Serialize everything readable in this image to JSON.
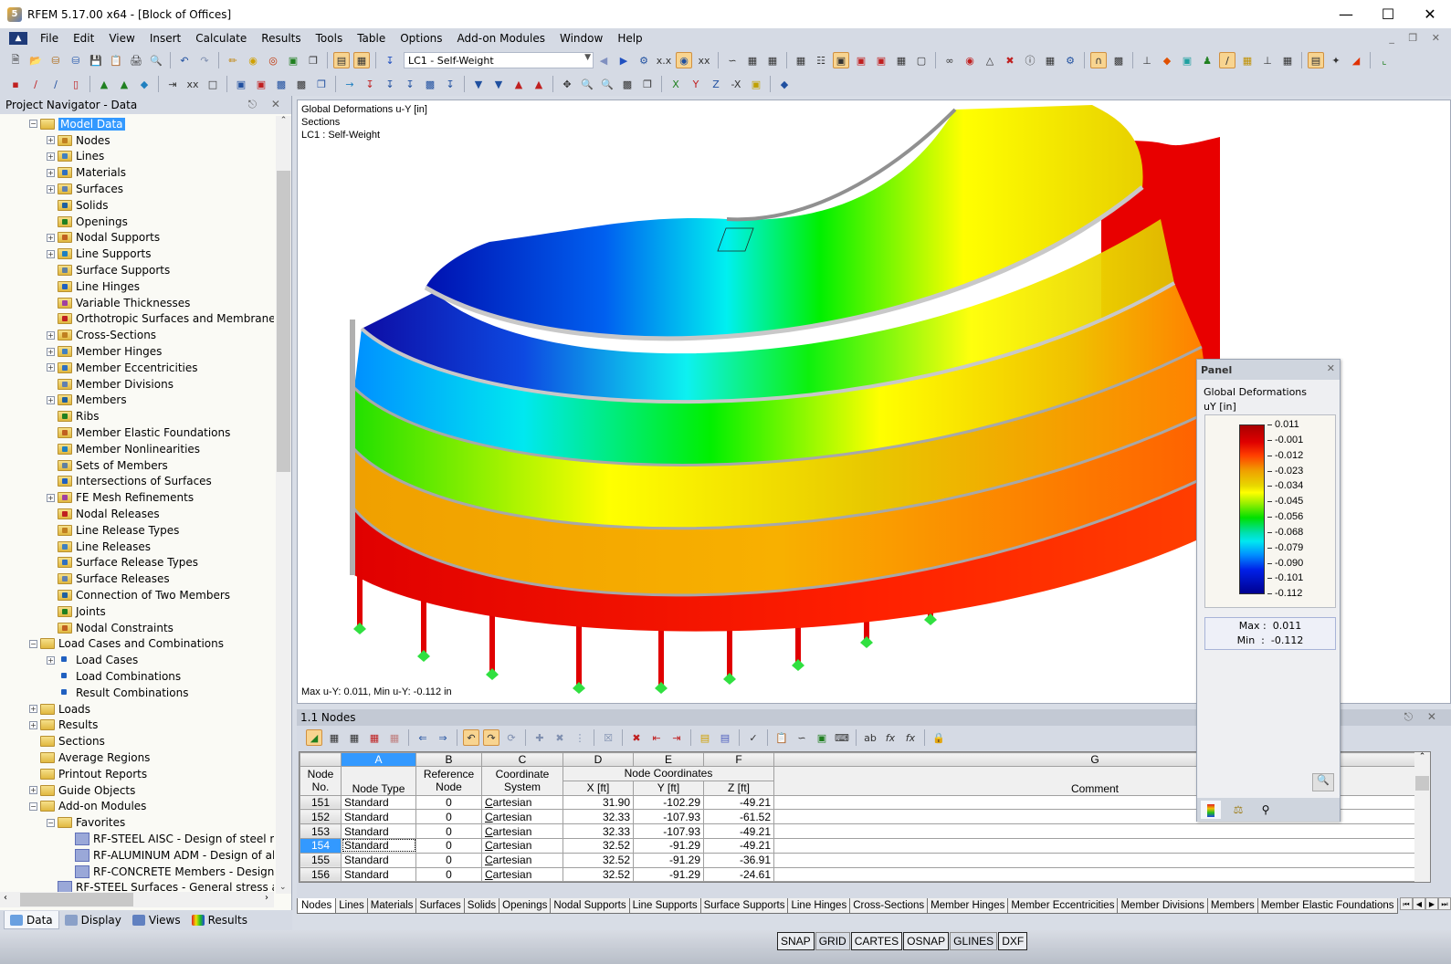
{
  "window": {
    "title": "RFEM 5.17.00 x64 - [Block of Offices]",
    "app_icon": "rfem-logo-icon",
    "controls": [
      "minimize",
      "maximize",
      "close"
    ]
  },
  "menu": {
    "items": [
      "File",
      "Edit",
      "View",
      "Insert",
      "Calculate",
      "Results",
      "Tools",
      "Table",
      "Options",
      "Add-on Modules",
      "Window",
      "Help"
    ]
  },
  "toolbar": {
    "load_case_selected": "LC1 - Self-Weight"
  },
  "navigator": {
    "title": "Project Navigator - Data",
    "items": [
      {
        "label": "Model Data",
        "level": 0,
        "expander": "minus",
        "selected": true
      },
      {
        "label": "Nodes",
        "level": 1,
        "expander": "plus"
      },
      {
        "label": "Lines",
        "level": 1,
        "expander": "plus"
      },
      {
        "label": "Materials",
        "level": 1,
        "expander": "plus"
      },
      {
        "label": "Surfaces",
        "level": 1,
        "expander": "plus"
      },
      {
        "label": "Solids",
        "level": 1,
        "expander": "none"
      },
      {
        "label": "Openings",
        "level": 1,
        "expander": "none"
      },
      {
        "label": "Nodal Supports",
        "level": 1,
        "expander": "plus"
      },
      {
        "label": "Line Supports",
        "level": 1,
        "expander": "plus"
      },
      {
        "label": "Surface Supports",
        "level": 1,
        "expander": "none"
      },
      {
        "label": "Line Hinges",
        "level": 1,
        "expander": "none"
      },
      {
        "label": "Variable Thicknesses",
        "level": 1,
        "expander": "none"
      },
      {
        "label": "Orthotropic Surfaces and Membranes",
        "level": 1,
        "expander": "none"
      },
      {
        "label": "Cross-Sections",
        "level": 1,
        "expander": "plus"
      },
      {
        "label": "Member Hinges",
        "level": 1,
        "expander": "plus"
      },
      {
        "label": "Member Eccentricities",
        "level": 1,
        "expander": "plus"
      },
      {
        "label": "Member Divisions",
        "level": 1,
        "expander": "none"
      },
      {
        "label": "Members",
        "level": 1,
        "expander": "plus"
      },
      {
        "label": "Ribs",
        "level": 1,
        "expander": "none"
      },
      {
        "label": "Member Elastic Foundations",
        "level": 1,
        "expander": "none"
      },
      {
        "label": "Member Nonlinearities",
        "level": 1,
        "expander": "none"
      },
      {
        "label": "Sets of Members",
        "level": 1,
        "expander": "none"
      },
      {
        "label": "Intersections of Surfaces",
        "level": 1,
        "expander": "none"
      },
      {
        "label": "FE Mesh Refinements",
        "level": 1,
        "expander": "plus"
      },
      {
        "label": "Nodal Releases",
        "level": 1,
        "expander": "none"
      },
      {
        "label": "Line Release Types",
        "level": 1,
        "expander": "none"
      },
      {
        "label": "Line Releases",
        "level": 1,
        "expander": "none"
      },
      {
        "label": "Surface Release Types",
        "level": 1,
        "expander": "none"
      },
      {
        "label": "Surface Releases",
        "level": 1,
        "expander": "none"
      },
      {
        "label": "Connection of Two Members",
        "level": 1,
        "expander": "none"
      },
      {
        "label": "Joints",
        "level": 1,
        "expander": "none"
      },
      {
        "label": "Nodal Constraints",
        "level": 1,
        "expander": "none"
      },
      {
        "label": "Load Cases and Combinations",
        "level": 0,
        "expander": "minus"
      },
      {
        "label": "Load Cases",
        "level": 1,
        "expander": "plus",
        "icon": "load-case-icon"
      },
      {
        "label": "Load Combinations",
        "level": 1,
        "expander": "none",
        "icon": "load-combination-icon"
      },
      {
        "label": "Result Combinations",
        "level": 1,
        "expander": "none",
        "icon": "result-combination-icon"
      },
      {
        "label": "Loads",
        "level": 0,
        "expander": "plus"
      },
      {
        "label": "Results",
        "level": 0,
        "expander": "plus"
      },
      {
        "label": "Sections",
        "level": 0,
        "expander": "none"
      },
      {
        "label": "Average Regions",
        "level": 0,
        "expander": "none"
      },
      {
        "label": "Printout Reports",
        "level": 0,
        "expander": "none"
      },
      {
        "label": "Guide Objects",
        "level": 0,
        "expander": "plus"
      },
      {
        "label": "Add-on Modules",
        "level": 0,
        "expander": "minus"
      },
      {
        "label": "Favorites",
        "level": 1,
        "expander": "minus"
      },
      {
        "label": "RF-STEEL AISC - Design of steel meml",
        "level": 2,
        "expander": "none",
        "icon": "module-icon"
      },
      {
        "label": "RF-ALUMINUM ADM - Design of alun",
        "level": 2,
        "expander": "none",
        "icon": "module-icon"
      },
      {
        "label": "RF-CONCRETE Members - Design of c",
        "level": 2,
        "expander": "none",
        "icon": "module-icon"
      },
      {
        "label": "RF-STEEL Surfaces - General stress analysi",
        "level": 1,
        "expander": "none",
        "icon": "module-icon"
      }
    ],
    "tabs": [
      "Data",
      "Display",
      "Views",
      "Results"
    ]
  },
  "viewport": {
    "info_lines": [
      "Global Deformations u-Y [in]",
      "Sections",
      "LC1 : Self-Weight"
    ],
    "maxmin": "Max u-Y: 0.011, Min u-Y: -0.112 in"
  },
  "panel": {
    "title": "Panel",
    "subtitle": "Global Deformations",
    "unit": "uY [in]",
    "legend_values": [
      "0.011",
      "-0.001",
      "-0.012",
      "-0.023",
      "-0.034",
      "-0.045",
      "-0.056",
      "-0.068",
      "-0.079",
      "-0.090",
      "-0.101",
      "-0.112"
    ],
    "max_label": "Max :  0.011",
    "min_label": "Min  :  -0.112",
    "colors": {
      "max": "#a80000",
      "mid": "#ffff00",
      "min": "#000090"
    }
  },
  "table": {
    "title": "1.1 Nodes",
    "column_letters": [
      "A",
      "B",
      "C",
      "D",
      "E",
      "F",
      "G"
    ],
    "headers": {
      "node_no": [
        "Node",
        "No."
      ],
      "node_type": "Node Type",
      "reference_node": [
        "Reference",
        "Node"
      ],
      "coordinate_system": [
        "Coordinate",
        "System"
      ],
      "node_coordinates": "Node Coordinates",
      "x": "X [ft]",
      "y": "Y [ft]",
      "z": "Z [ft]",
      "comment": "Comment"
    },
    "rows": [
      {
        "no": "151",
        "type": "Standard",
        "ref": "0",
        "cs": "Cartesian",
        "x": "31.90",
        "y": "-102.29",
        "z": "-49.21",
        "comment": ""
      },
      {
        "no": "152",
        "type": "Standard",
        "ref": "0",
        "cs": "Cartesian",
        "x": "32.33",
        "y": "-107.93",
        "z": "-61.52",
        "comment": ""
      },
      {
        "no": "153",
        "type": "Standard",
        "ref": "0",
        "cs": "Cartesian",
        "x": "32.33",
        "y": "-107.93",
        "z": "-49.21",
        "comment": ""
      },
      {
        "no": "154",
        "type": "Standard",
        "ref": "0",
        "cs": "Cartesian",
        "x": "32.52",
        "y": "-91.29",
        "z": "-49.21",
        "comment": "",
        "selected": true
      },
      {
        "no": "155",
        "type": "Standard",
        "ref": "0",
        "cs": "Cartesian",
        "x": "32.52",
        "y": "-91.29",
        "z": "-36.91",
        "comment": ""
      },
      {
        "no": "156",
        "type": "Standard",
        "ref": "0",
        "cs": "Cartesian",
        "x": "32.52",
        "y": "-91.29",
        "z": "-24.61",
        "comment": ""
      }
    ],
    "sheet_tabs": [
      "Nodes",
      "Lines",
      "Materials",
      "Surfaces",
      "Solids",
      "Openings",
      "Nodal Supports",
      "Line Supports",
      "Surface Supports",
      "Line Hinges",
      "Cross-Sections",
      "Member Hinges",
      "Member Eccentricities",
      "Member Divisions",
      "Members",
      "Member Elastic Foundations"
    ],
    "active_tab": "Nodes"
  },
  "statusbar": {
    "items": [
      {
        "label": "SNAP",
        "on": true
      },
      {
        "label": "GRID",
        "on": false
      },
      {
        "label": "CARTES",
        "on": true
      },
      {
        "label": "OSNAP",
        "on": true
      },
      {
        "label": "GLINES",
        "on": false
      },
      {
        "label": "DXF",
        "on": true
      }
    ]
  }
}
